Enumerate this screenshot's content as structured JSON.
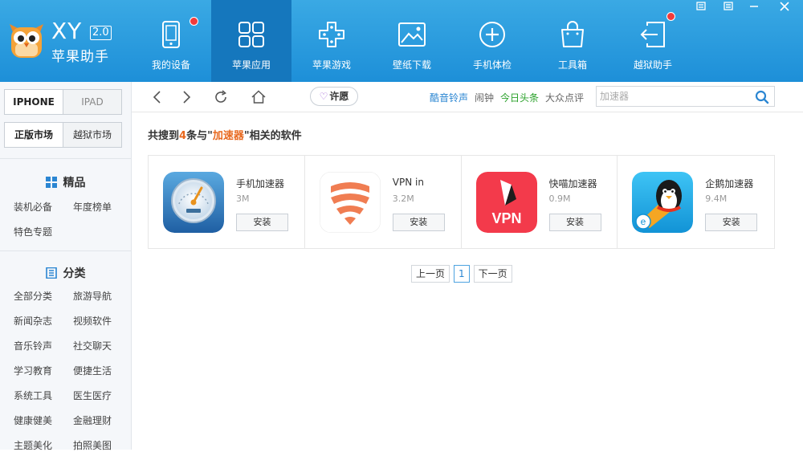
{
  "app": {
    "logo_text": "XY",
    "version": "2.0",
    "name": "苹果助手"
  },
  "nav": [
    {
      "label": "我的设备",
      "icon": "device-icon",
      "badge": true
    },
    {
      "label": "苹果应用",
      "icon": "apps-grid-icon",
      "active": true
    },
    {
      "label": "苹果游戏",
      "icon": "game-icon"
    },
    {
      "label": "壁纸下载",
      "icon": "wallpaper-icon"
    },
    {
      "label": "手机体检",
      "icon": "checkup-icon"
    },
    {
      "label": "工具箱",
      "icon": "toolbox-icon"
    },
    {
      "label": "越狱助手",
      "icon": "jailbreak-icon",
      "badge": true
    }
  ],
  "sidebar": {
    "device_tabs": [
      "IPHONE",
      "IPAD"
    ],
    "market_tabs": [
      "正版市场",
      "越狱市场"
    ],
    "featured": {
      "title": "精品",
      "items": [
        "装机必备",
        "年度榜单",
        "特色专题"
      ]
    },
    "category": {
      "title": "分类",
      "items": [
        "全部分类",
        "旅游导航",
        "新闻杂志",
        "视频软件",
        "音乐铃声",
        "社交聊天",
        "学习教育",
        "便捷生活",
        "系统工具",
        "医生医疗",
        "健康健美",
        "金融理财",
        "主题美化",
        "拍照美图"
      ]
    }
  },
  "toolbar": {
    "wish_label": "许愿",
    "quick_links": [
      {
        "label": "酷音铃声",
        "color": "#2b86d2"
      },
      {
        "label": "闹钟",
        "color": "#666666"
      },
      {
        "label": "今日头条",
        "color": "#2aa12a"
      },
      {
        "label": "大众点评",
        "color": "#666666"
      }
    ],
    "search_placeholder": "加速器"
  },
  "results": {
    "prefix": "共搜到",
    "count": "4",
    "middle": "条与\"",
    "keyword": "加速器",
    "suffix": "\"相关的软件",
    "apps": [
      {
        "name": "手机加速器",
        "size": "3M",
        "install": "安装",
        "icon": "speedometer-app-icon"
      },
      {
        "name": "VPN in",
        "size": "3.2M",
        "install": "安装",
        "icon": "vpn-in-app-icon"
      },
      {
        "name": "快喵加速器",
        "size": "0.9M",
        "install": "安装",
        "icon": "vpn-red-app-icon"
      },
      {
        "name": "企鹅加速器",
        "size": "9.4M",
        "install": "安装",
        "icon": "penguin-app-icon"
      }
    ]
  },
  "pager": {
    "prev": "上一页",
    "current": "1",
    "next": "下一页"
  },
  "colors": {
    "header": "#1d8fd8",
    "active_nav": "#1577bd",
    "accent": "#e8681e",
    "badge": "#f23b3b"
  }
}
